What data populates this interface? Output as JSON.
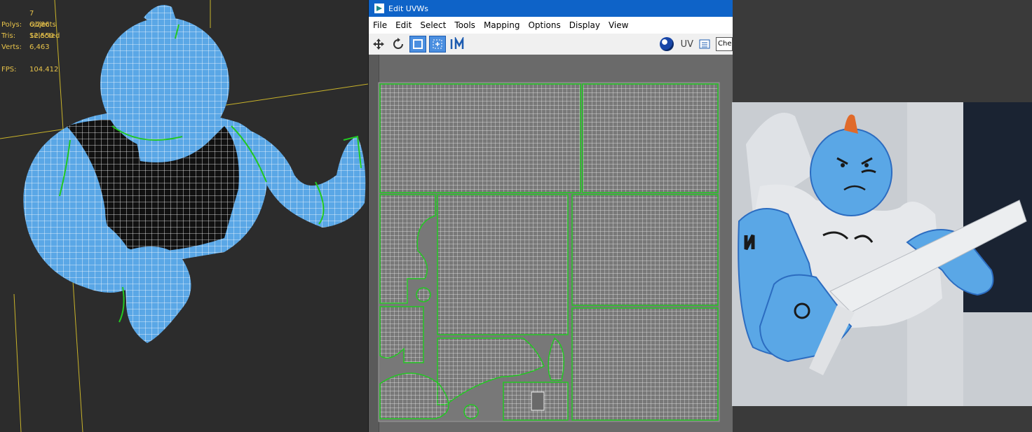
{
  "viewport": {
    "selection": "7 Objects Selected",
    "stats": [
      {
        "label": "Polys:",
        "value": "6,286"
      },
      {
        "label": "Tris:",
        "value": "12,550"
      },
      {
        "label": "Verts:",
        "value": "6,463"
      },
      {
        "label": "FPS:",
        "value": "104.412"
      }
    ]
  },
  "uvw_window": {
    "title": "Edit UVWs",
    "menu": [
      "File",
      "Edit",
      "Select",
      "Tools",
      "Mapping",
      "Options",
      "Display",
      "View"
    ],
    "uv_label": "UV",
    "checker_combo": "Che"
  },
  "colors": {
    "stats_text": "#e8c34a",
    "title_bar": "#0e63c8",
    "seam_green": "#22c822",
    "character_blue": "#5aa7e6"
  }
}
